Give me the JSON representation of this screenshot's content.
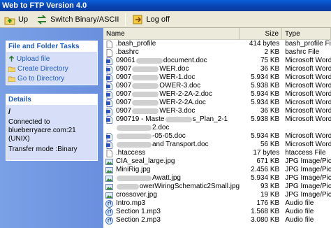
{
  "window": {
    "title": "Web to FTP Version 4.0"
  },
  "toolbar": {
    "up_label": "Up",
    "switch_label": "Switch Binary/ASCII",
    "logoff_label": "Log off"
  },
  "tasks_panel": {
    "title": "File and Folder Tasks",
    "items": [
      "Upload file",
      "Create Directory",
      "Go to Directory"
    ]
  },
  "details_panel": {
    "title": "Details",
    "path": "/",
    "connected_to": "Connected to",
    "server": "blueberryacre.com:21 (UNIX)",
    "transfer_mode": "Transfer mode :Binary"
  },
  "columns": {
    "name": "Name",
    "size": "Size",
    "type": "Type"
  },
  "files": [
    {
      "pre": ".bash_profile",
      "post": "",
      "size": "414 bytes",
      "type": "bash_profile File",
      "icon": "blank-file-icon"
    },
    {
      "pre": ".bashrc",
      "post": "",
      "size": "2 KB",
      "type": "bashrc File",
      "icon": "blank-file-icon"
    },
    {
      "pre": "09061",
      "post": "document.doc",
      "size": "75 KB",
      "type": "Microsoft Word Doc",
      "icon": "word-doc-icon"
    },
    {
      "pre": "0907",
      "post": "WER.doc",
      "size": "36 KB",
      "type": "Microsoft Word Doc",
      "icon": "word-doc-icon"
    },
    {
      "pre": "0907",
      "post": "WER-1.doc",
      "size": "5.934 KB",
      "type": "Microsoft Word Doc",
      "icon": "word-doc-icon"
    },
    {
      "pre": "0907",
      "post": "OWER-3.doc",
      "size": "5.938 KB",
      "type": "Microsoft Word Doc",
      "icon": "word-doc-icon"
    },
    {
      "pre": "0907",
      "post": "WER-2-2A-2.doc",
      "size": "5.934 KB",
      "type": "Microsoft Word Doc",
      "icon": "word-doc-icon"
    },
    {
      "pre": "0907",
      "post": "WER-2-2A.doc",
      "size": "5.934 KB",
      "type": "Microsoft Word Doc",
      "icon": "word-doc-icon"
    },
    {
      "pre": "0907",
      "post": "WER-3.doc",
      "size": "36 KB",
      "type": "Microsoft Word Doc",
      "icon": "word-doc-icon"
    },
    {
      "pre": "090719 - Maste",
      "post": "s_Plan_2-1",
      "size": "5.938 KB",
      "type": "Microsoft Word Doc",
      "icon": "word-doc-icon"
    },
    {
      "pre": "",
      "post": "2.doc",
      "size": "",
      "type": "",
      "icon": ""
    },
    {
      "pre": "",
      "post": "-05-05.doc",
      "size": "5.934 KB",
      "type": "Microsoft Word Doc",
      "icon": "word-doc-icon"
    },
    {
      "pre": "",
      "post": "and Transport.doc",
      "size": "56 KB",
      "type": "Microsoft Word Doc",
      "icon": "word-doc-icon"
    },
    {
      "pre": ".htaccess",
      "post": "",
      "size": "17 bytes",
      "type": "htaccess File",
      "icon": "blank-file-icon"
    },
    {
      "pre": "CIA_seal_large.jpg",
      "post": "",
      "size": "671 KB",
      "type": "JPG Image/Picture",
      "icon": "image-icon"
    },
    {
      "pre": "MiniRig.jpg",
      "post": "",
      "size": "2.456 KB",
      "type": "JPG Image/Picture",
      "icon": "image-icon"
    },
    {
      "pre": "",
      "post": "Awatt.jpg",
      "size": "5.934 KB",
      "type": "JPG Image/Picture",
      "icon": "image-icon"
    },
    {
      "pre": "",
      "post": "owerWiringSchematic2Small.jpg",
      "size": "93 KB",
      "type": "JPG Image/Picture",
      "icon": "image-icon"
    },
    {
      "pre": "crossover.jpg",
      "post": "",
      "size": "19 KB",
      "type": "JPG Image/Picture",
      "icon": "image-icon"
    },
    {
      "pre": "Intro.mp3",
      "post": "",
      "size": "176 KB",
      "type": "Audio file",
      "icon": "audio-icon"
    },
    {
      "pre": "Section 1.mp3",
      "post": "",
      "size": "1.568 KB",
      "type": "Audio file",
      "icon": "audio-icon"
    },
    {
      "pre": "Section 2.mp3",
      "post": "",
      "size": "3.080 KB",
      "type": "Audio file",
      "icon": "audio-icon"
    }
  ]
}
